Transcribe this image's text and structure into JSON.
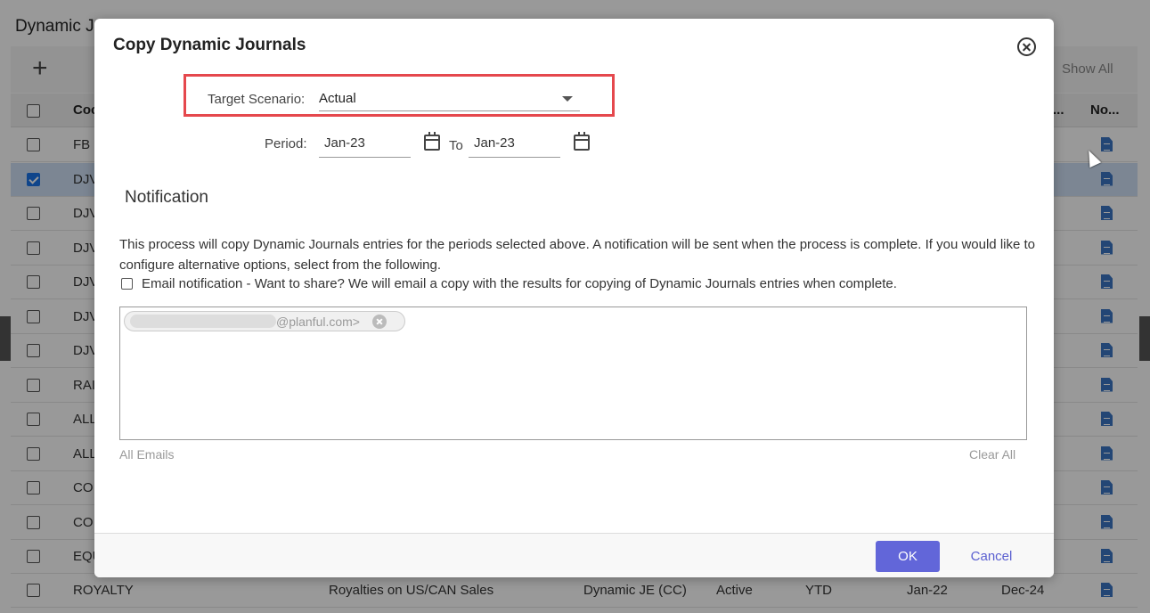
{
  "background": {
    "page_title": "Dynamic J",
    "toolbar": {
      "add_label": "+",
      "show_all": "Show All"
    },
    "headers": {
      "code": "Coc",
      "ellipsis": "...",
      "notes": "No..."
    },
    "rows": [
      {
        "code": "FB",
        "selected": false
      },
      {
        "code": "DJV",
        "selected": true
      },
      {
        "code": "DJV",
        "selected": false
      },
      {
        "code": "DJV",
        "selected": false
      },
      {
        "code": "DJV",
        "selected": false
      },
      {
        "code": "DJV",
        "selected": false
      },
      {
        "code": "DJV",
        "selected": false
      },
      {
        "code": "RAI",
        "selected": false
      },
      {
        "code": "ALL",
        "selected": false
      },
      {
        "code": "ALL",
        "selected": false
      },
      {
        "code": "CO",
        "selected": false
      },
      {
        "code": "CO",
        "selected": false
      },
      {
        "code": "EQU",
        "selected": false
      }
    ],
    "last_row": {
      "code": "ROYALTY",
      "description": "Royalties on US/CAN Sales",
      "type": "Dynamic JE (CC)",
      "status": "Active",
      "basis": "YTD",
      "start": "Jan-22",
      "end": "Dec-24"
    }
  },
  "modal": {
    "title": "Copy Dynamic Journals",
    "target_scenario_label": "Target Scenario:",
    "target_scenario_value": "Actual",
    "period_label": "Period:",
    "period_from": "Jan-23",
    "to_label": "To",
    "period_to": "Jan-23",
    "notification_title": "Notification",
    "description": "This process will copy Dynamic Journals entries for the periods selected above. A notification will be sent when the process is complete. If you would like to configure alternative options, select from the following.",
    "email_notification_label": "Email notification - Want to share? We will email a copy with the results for copying of Dynamic Journals entries when complete.",
    "email_chip": "@planful.com>",
    "all_emails": "All Emails",
    "clear_all": "Clear All",
    "ok_label": "OK",
    "cancel_label": "Cancel"
  },
  "colors": {
    "primary_button": "#6266d9",
    "highlight": "#e5484d",
    "selected_row": "#cfe0f5"
  }
}
